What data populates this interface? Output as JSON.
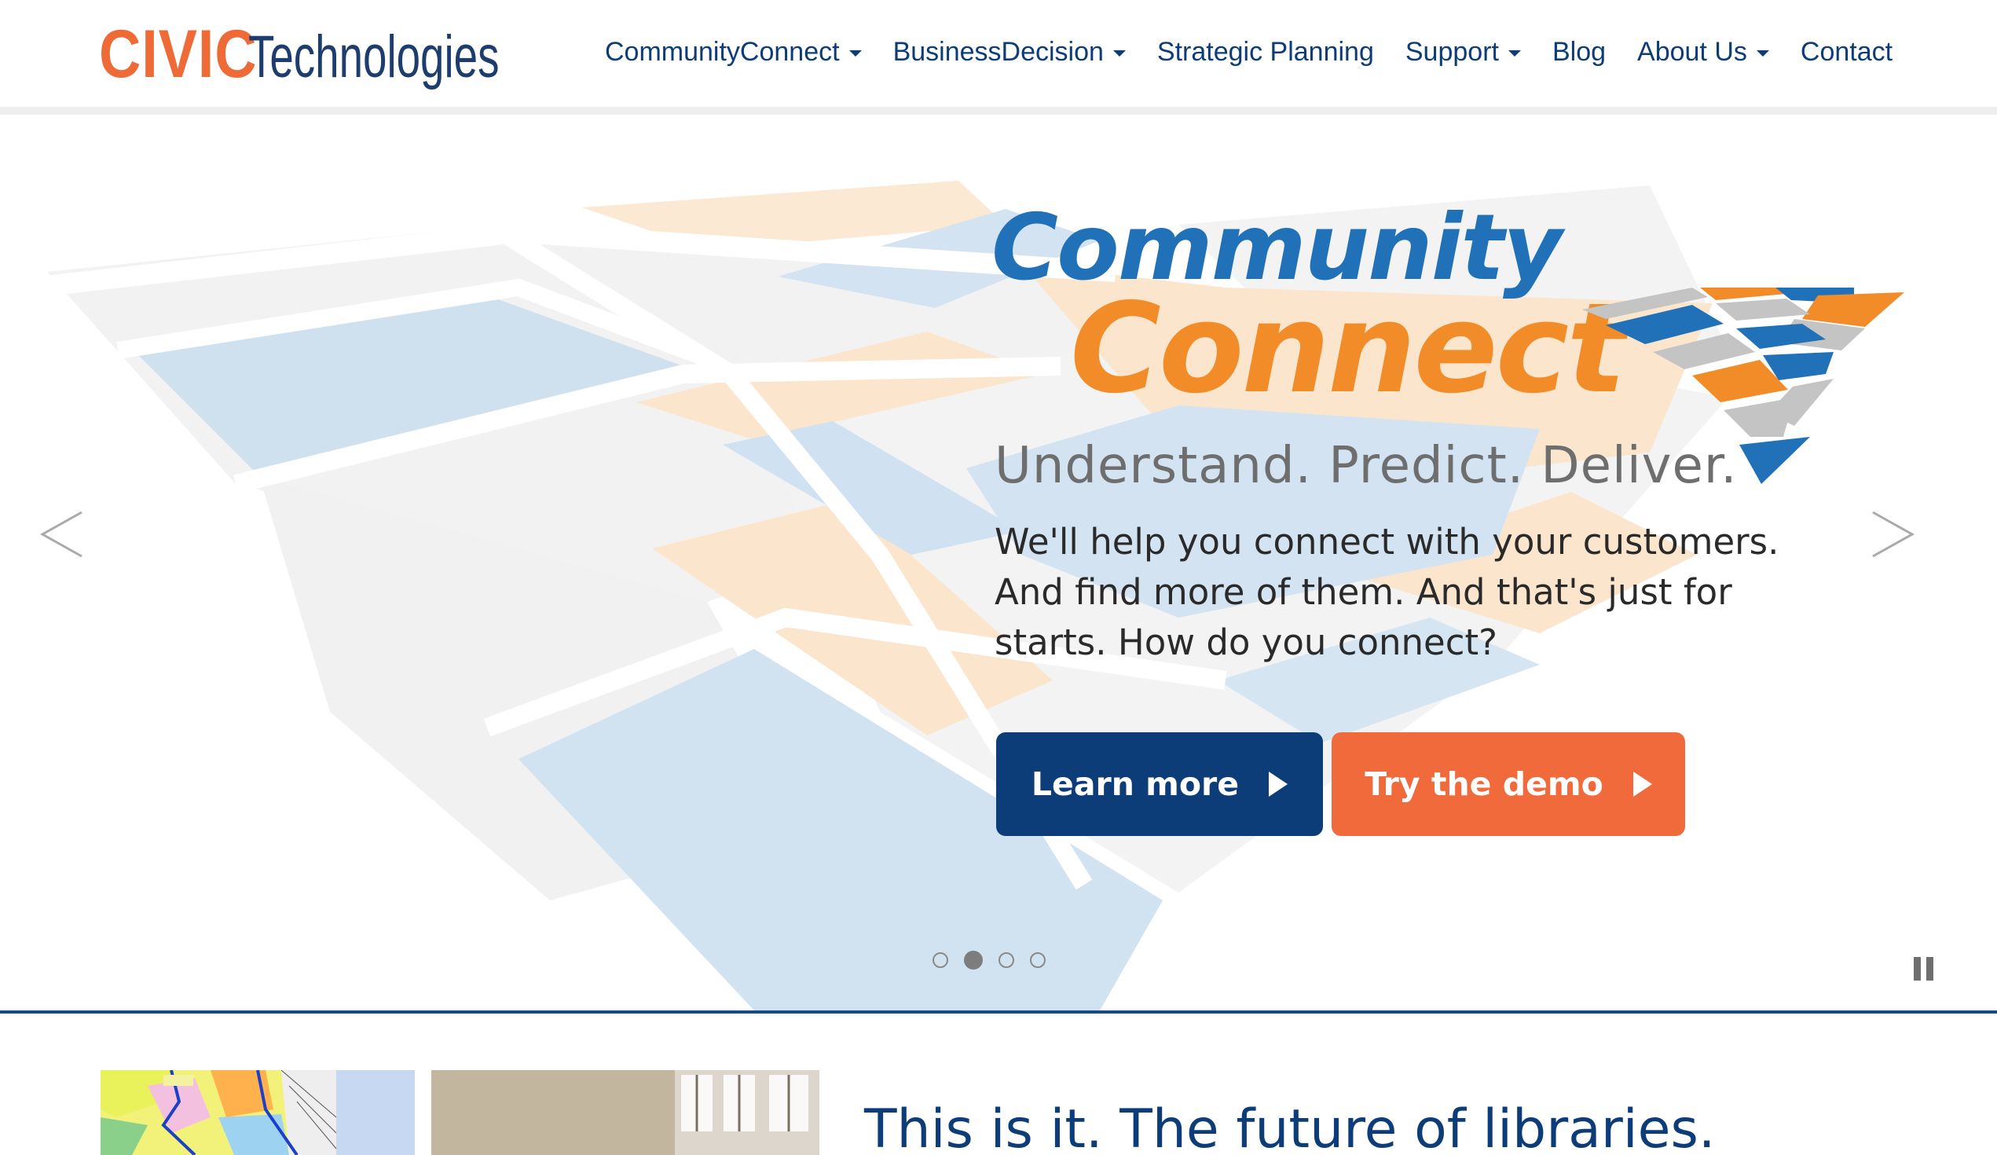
{
  "header": {
    "logo_civic": "CIVIC",
    "logo_technologies": "Technologies",
    "nav": [
      {
        "label": "CommunityConnect",
        "dropdown": true
      },
      {
        "label": "BusinessDecision",
        "dropdown": true
      },
      {
        "label": "Strategic Planning",
        "dropdown": false
      },
      {
        "label": "Support",
        "dropdown": true
      },
      {
        "label": "Blog",
        "dropdown": false
      },
      {
        "label": "About Us",
        "dropdown": true
      },
      {
        "label": "Contact",
        "dropdown": false
      }
    ]
  },
  "hero": {
    "product_line1": "Community",
    "product_line2": "Connect",
    "tagline": "Understand. Predict. Deliver.",
    "body_lines": [
      "We'll help you connect with your customers.",
      "And find more of them. And that's just for",
      "starts. How do you connect?"
    ],
    "learn_more_label": "Learn more",
    "try_demo_label": "Try the demo",
    "slide_count": 4,
    "active_slide": 2
  },
  "section": {
    "title": "This is it. The future of libraries."
  },
  "icons": {
    "prev": "chevron-left-icon",
    "next": "chevron-right-icon",
    "pause": "pause-icon",
    "button_arrow": "play-triangle-icon",
    "nav_caret": "caret-down-icon"
  },
  "colors": {
    "brand_orange": "#ee6a37",
    "brand_navy": "#0d3d78",
    "community_blue": "#2171b9",
    "connect_orange": "#f28c28",
    "demo_button": "#f06a3b"
  }
}
